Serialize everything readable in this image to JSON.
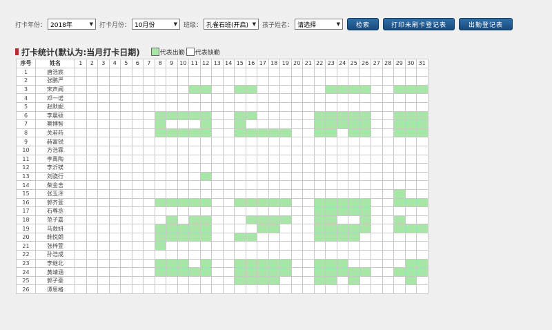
{
  "filters": {
    "year_label": "打卡年份：",
    "year_value": "2018年",
    "month_label": "打卡月份：",
    "month_value": "10月份",
    "class_label": "班级：",
    "class_value": "孔雀石班(开启)",
    "child_label": "孩子姓名：",
    "child_value": "请选择"
  },
  "buttons": {
    "search": "检索",
    "print_unswiped": "打印未刷卡登记表",
    "attendance_register": "出勤登记表"
  },
  "section": {
    "title": "打卡统计(默认为:当月打卡日期)",
    "legend_present": "代表出勤",
    "legend_absent": "代表缺勤"
  },
  "colors": {
    "present": "#a8e6a8",
    "absent": "#ffffff",
    "accent": "#1f5a92"
  },
  "table": {
    "col_index": "序号",
    "col_name": "姓名",
    "days": [
      "1",
      "2",
      "3",
      "4",
      "5",
      "6",
      "7",
      "8",
      "9",
      "10",
      "11",
      "12",
      "13",
      "14",
      "15",
      "16",
      "17",
      "18",
      "19",
      "20",
      "21",
      "22",
      "23",
      "24",
      "25",
      "26",
      "27",
      "28",
      "29",
      "30",
      "31"
    ],
    "rows": [
      {
        "no": "1",
        "name": "唐浩宸",
        "present": []
      },
      {
        "no": "2",
        "name": "张鹏严",
        "present": []
      },
      {
        "no": "3",
        "name": "宋声闻",
        "present": [
          11,
          12,
          15,
          16,
          23,
          24,
          25,
          26,
          29,
          30,
          31
        ]
      },
      {
        "no": "4",
        "name": "邓一诺",
        "present": []
      },
      {
        "no": "5",
        "name": "赵默妮",
        "present": []
      },
      {
        "no": "6",
        "name": "李晨硕",
        "present": [
          8,
          9,
          10,
          11,
          12,
          15,
          16,
          22,
          23,
          24,
          25,
          26,
          29,
          30,
          31
        ]
      },
      {
        "no": "7",
        "name": "窦博智",
        "present": [
          8,
          12,
          15,
          22,
          23,
          24,
          25,
          26,
          29,
          30,
          31
        ]
      },
      {
        "no": "8",
        "name": "关若药",
        "present": [
          8,
          9,
          10,
          11,
          12,
          15,
          16,
          17,
          18,
          19,
          22,
          23,
          25,
          26,
          29,
          30,
          31
        ]
      },
      {
        "no": "9",
        "name": "赫富锐",
        "present": []
      },
      {
        "no": "10",
        "name": "方浩霖",
        "present": []
      },
      {
        "no": "11",
        "name": "李禹陶",
        "present": []
      },
      {
        "no": "12",
        "name": "李沂镁",
        "present": []
      },
      {
        "no": "13",
        "name": "刘骁行",
        "present": [
          12
        ]
      },
      {
        "no": "14",
        "name": "柴金舍",
        "present": []
      },
      {
        "no": "15",
        "name": "张玉泽",
        "present": [
          29
        ]
      },
      {
        "no": "16",
        "name": "郭齐萱",
        "present": [
          8,
          9,
          10,
          11,
          12,
          15,
          16,
          17,
          18,
          19,
          22,
          23,
          24,
          25,
          26,
          29,
          30,
          31
        ]
      },
      {
        "no": "17",
        "name": "石尊丞",
        "present": [
          22,
          23,
          24,
          25,
          26
        ]
      },
      {
        "no": "18",
        "name": "范子嘉",
        "present": [
          9,
          11,
          12,
          16,
          17,
          18,
          19,
          22,
          23,
          26,
          29
        ]
      },
      {
        "no": "19",
        "name": "马敖妍",
        "present": [
          8,
          9,
          10,
          11,
          12,
          17,
          18,
          22,
          23,
          24,
          25,
          26,
          29,
          30,
          31
        ]
      },
      {
        "no": "20",
        "name": "韩悦朗",
        "present": [
          8,
          9,
          10,
          11,
          12,
          15,
          16,
          22,
          23,
          24,
          25
        ]
      },
      {
        "no": "21",
        "name": "张梓萱",
        "present": [
          8
        ]
      },
      {
        "no": "22",
        "name": "孙浩成",
        "present": []
      },
      {
        "no": "23",
        "name": "李继北",
        "present": [
          8,
          9,
          10,
          12,
          15,
          16,
          17,
          18,
          19,
          22,
          23,
          24,
          30,
          31
        ]
      },
      {
        "no": "24",
        "name": "黄靖涵",
        "present": [
          8,
          9,
          10,
          11,
          12,
          15,
          16,
          17,
          18,
          19,
          22,
          23,
          24,
          25,
          26,
          29,
          30,
          31
        ]
      },
      {
        "no": "25",
        "name": "郭子豪",
        "present": [
          15,
          16,
          17,
          18,
          22,
          23,
          25,
          30
        ]
      },
      {
        "no": "26",
        "name": "谭思格",
        "present": []
      }
    ]
  }
}
